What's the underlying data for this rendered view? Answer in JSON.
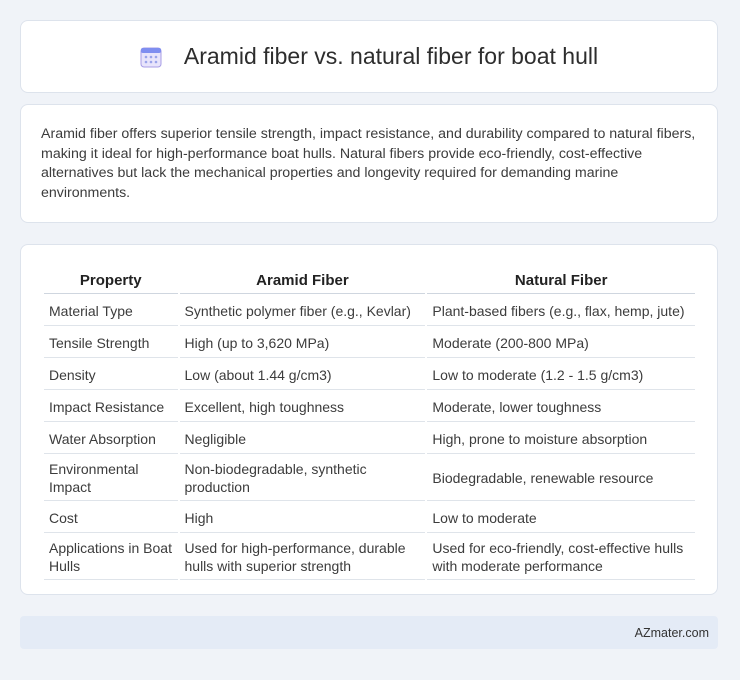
{
  "header": {
    "title": "Aramid fiber vs. natural fiber for boat hull",
    "icon": "calendar-icon"
  },
  "intro": {
    "text": "Aramid fiber offers superior tensile strength, impact resistance, and durability compared to natural fibers, making it ideal for high-performance boat hulls. Natural fibers provide eco-friendly, cost-effective alternatives but lack the mechanical properties and longevity required for demanding marine environments."
  },
  "table": {
    "headers": [
      "Property",
      "Aramid Fiber",
      "Natural Fiber"
    ],
    "rows": [
      [
        "Material Type",
        "Synthetic polymer fiber (e.g., Kevlar)",
        "Plant-based fibers (e.g., flax, hemp, jute)"
      ],
      [
        "Tensile Strength",
        "High (up to 3,620 MPa)",
        "Moderate (200-800 MPa)"
      ],
      [
        "Density",
        "Low (about 1.44 g/cm3)",
        "Low to moderate (1.2 - 1.5 g/cm3)"
      ],
      [
        "Impact Resistance",
        "Excellent, high toughness",
        "Moderate, lower toughness"
      ],
      [
        "Water Absorption",
        "Negligible",
        "High, prone to moisture absorption"
      ],
      [
        "Environmental Impact",
        "Non-biodegradable, synthetic production",
        "Biodegradable, renewable resource"
      ],
      [
        "Cost",
        "High",
        "Low to moderate"
      ],
      [
        "Applications in Boat Hulls",
        "Used for high-performance, durable hulls with superior strength",
        "Used for eco-friendly, cost-effective hulls with moderate performance"
      ]
    ]
  },
  "footer": {
    "brand": "AZmater.com"
  }
}
